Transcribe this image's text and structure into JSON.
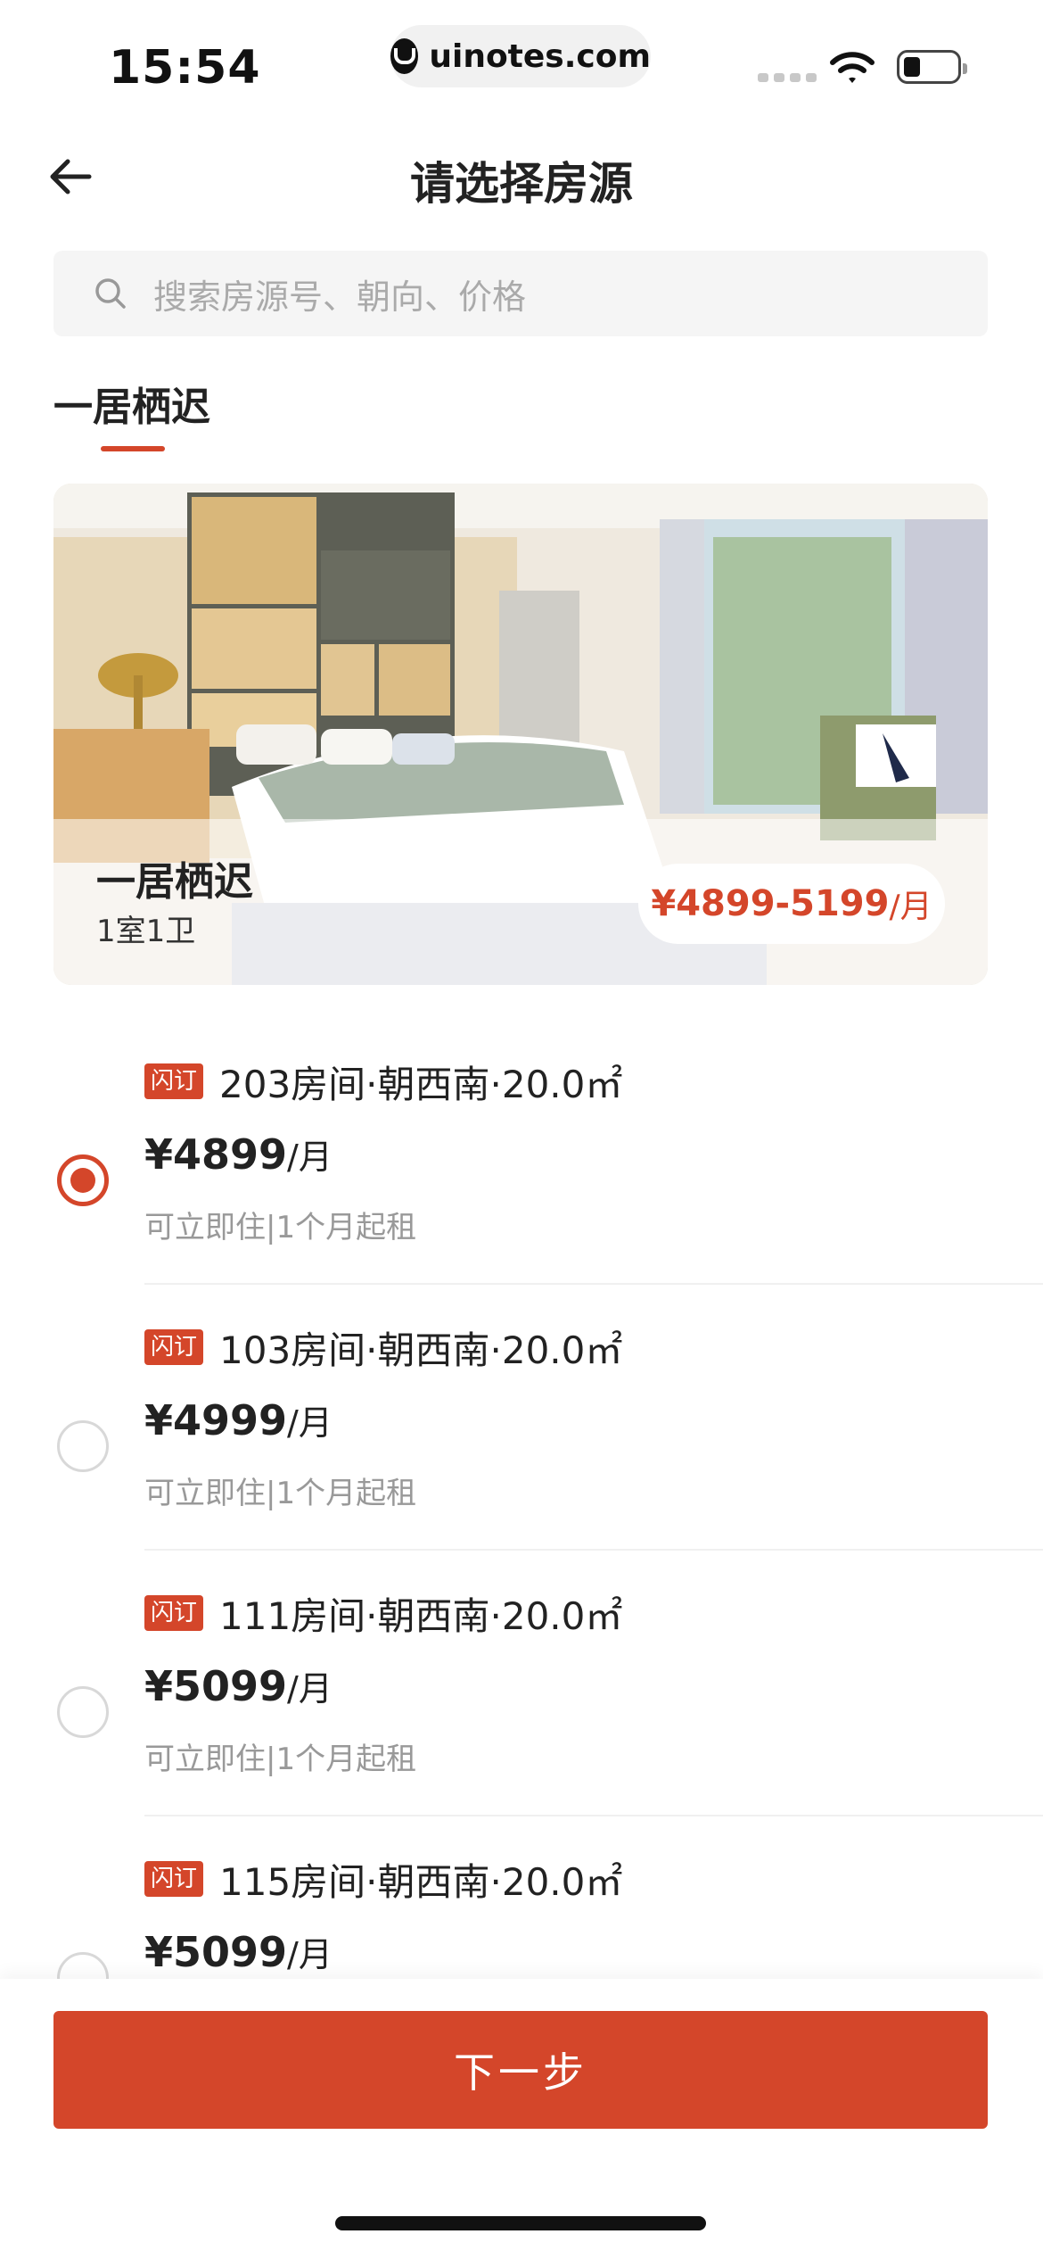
{
  "status_bar": {
    "time": "15:54",
    "url": "uinotes.com"
  },
  "nav": {
    "title": "请选择房源"
  },
  "search": {
    "placeholder": "搜索房源号、朝向、价格"
  },
  "tabs": [
    {
      "label": "一居栖迟",
      "active": true
    }
  ],
  "hero": {
    "name": "一居栖迟",
    "sub": "1室1卫",
    "price_range": "¥4899-5199",
    "price_unit": "/月"
  },
  "rooms": [
    {
      "badge": "闪订",
      "title": "203房间·朝西南·20.0㎡",
      "price": "¥4899",
      "unit": "/月",
      "tags": "可立即住|1个月起租",
      "selected": true
    },
    {
      "badge": "闪订",
      "title": "103房间·朝西南·20.0㎡",
      "price": "¥4999",
      "unit": "/月",
      "tags": "可立即住|1个月起租",
      "selected": false
    },
    {
      "badge": "闪订",
      "title": "111房间·朝西南·20.0㎡",
      "price": "¥5099",
      "unit": "/月",
      "tags": "可立即住|1个月起租",
      "selected": false
    },
    {
      "badge": "闪订",
      "title": "115房间·朝西南·20.0㎡",
      "price": "¥5099",
      "unit": "/月",
      "tags": "",
      "selected": false
    }
  ],
  "footer": {
    "next_label": "下一步"
  },
  "colors": {
    "accent": "#d4462a",
    "muted_text": "#999999",
    "search_bg": "#f5f5f5"
  }
}
